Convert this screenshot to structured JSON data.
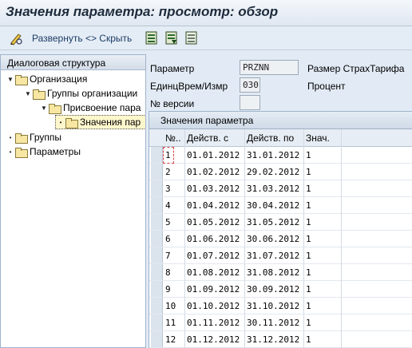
{
  "window": {
    "title": "Значения параметра: просмотр: обзор"
  },
  "toolbar": {
    "expand_label": "Развернуть <> Скрыть",
    "icons": [
      "pencil-glasses-icon",
      "display-list-icon",
      "select-list-icon",
      "deselect-list-icon"
    ]
  },
  "tree": {
    "header": "Диалоговая структура",
    "nodes": [
      {
        "label": "Организация",
        "toggle": "▼"
      },
      {
        "label": "Группы организации",
        "toggle": "▼"
      },
      {
        "label": "Присвоение пара",
        "toggle": "▼"
      },
      {
        "label": "Значения пар",
        "toggle": "•"
      },
      {
        "label": "Группы",
        "toggle": "•"
      },
      {
        "label": "Параметры",
        "toggle": "•"
      }
    ]
  },
  "form": {
    "param_label": "Параметр",
    "param_value": "PRZNN",
    "param_desc": "Размер СтрахТарифа",
    "unit_label": "ЕдинцВрем/Измр",
    "unit_value": "030",
    "unit_desc": "Процент",
    "version_label": "№ версии",
    "version_value": ""
  },
  "table": {
    "caption": "Значения параметра",
    "columns": [
      "№..",
      "Действ. с",
      "Действ. по",
      "Знач."
    ],
    "rows": [
      [
        "1",
        "01.01.2012",
        "31.01.2012",
        "1"
      ],
      [
        "2",
        "01.02.2012",
        "29.02.2012",
        "1"
      ],
      [
        "3",
        "01.03.2012",
        "31.03.2012",
        "1"
      ],
      [
        "4",
        "01.04.2012",
        "30.04.2012",
        "1"
      ],
      [
        "5",
        "01.05.2012",
        "31.05.2012",
        "1"
      ],
      [
        "6",
        "01.06.2012",
        "30.06.2012",
        "1"
      ],
      [
        "7",
        "01.07.2012",
        "31.07.2012",
        "1"
      ],
      [
        "8",
        "01.08.2012",
        "31.08.2012",
        "1"
      ],
      [
        "9",
        "01.09.2012",
        "30.09.2012",
        "1"
      ],
      [
        "10",
        "01.10.2012",
        "31.10.2012",
        "1"
      ],
      [
        "11",
        "01.11.2012",
        "30.11.2012",
        "1"
      ],
      [
        "12",
        "01.12.2012",
        "31.12.2012",
        "1"
      ]
    ]
  }
}
